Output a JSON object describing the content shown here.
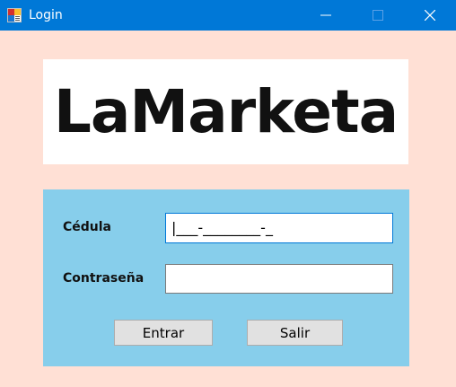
{
  "window": {
    "title": "Login",
    "icons": {
      "app": "app-icon",
      "minimize": "minimize-icon",
      "maximize": "maximize-icon",
      "close": "close-icon"
    },
    "colors": {
      "titlebar": "#0078d7",
      "background": "#ffe0d5",
      "form_panel": "#87ceeb"
    }
  },
  "logo": {
    "text": "LaMarketa"
  },
  "form": {
    "cedula_label": "Cédula",
    "cedula_value": "|___-________-_",
    "password_label": "Contraseña",
    "password_value": "",
    "enter_button": "Entrar",
    "exit_button": "Salir"
  }
}
